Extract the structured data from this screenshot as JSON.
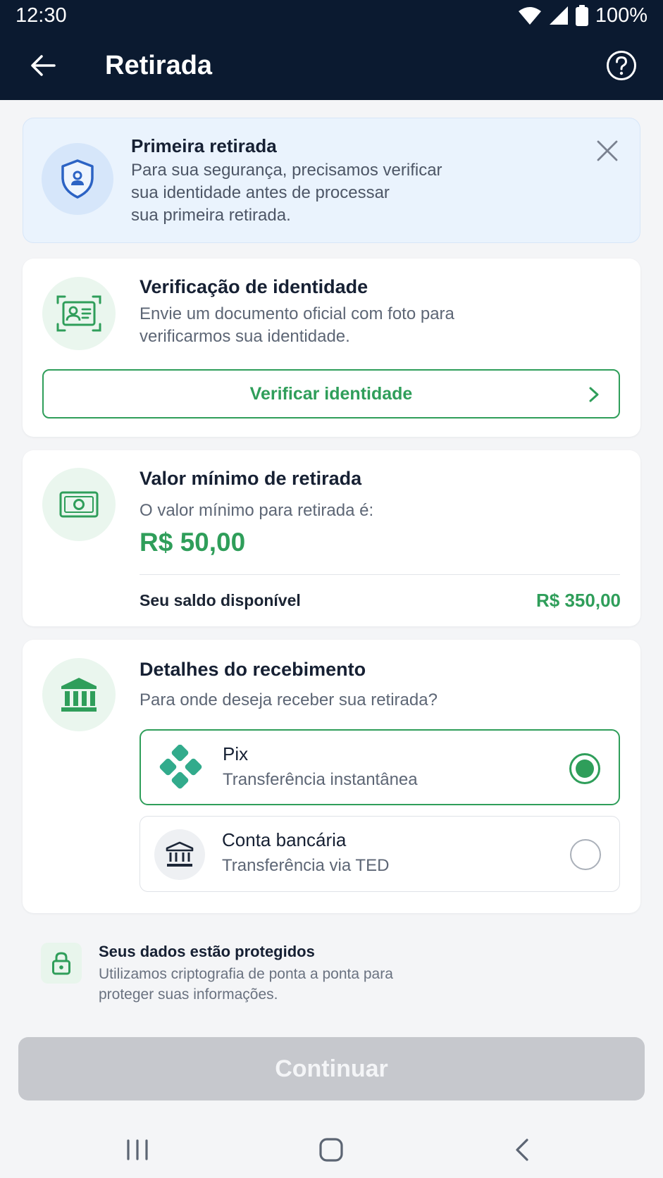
{
  "status_bar": {
    "time": "12:30",
    "battery": "100%"
  },
  "header": {
    "title": "Retirada"
  },
  "banner": {
    "title": "Primeira retirada",
    "line1": "Para sua segurança, precisamos verificar",
    "line2": "sua identidade antes de processar",
    "line3": "sua primeira retirada."
  },
  "identity": {
    "title": "Verificação de identidade",
    "line1": "Envie um documento oficial com foto para",
    "line2": "verificarmos sua identidade.",
    "button_label": "Verificar identidade"
  },
  "minimum": {
    "title": "Valor mínimo de retirada",
    "description": "O valor mínimo para retirada é:",
    "amount": "R$ 50,00",
    "balance_label": "Seu saldo disponível",
    "balance_value": "R$ 350,00"
  },
  "receipt": {
    "title": "Detalhes do recebimento",
    "question": "Para onde deseja receber sua retirada?",
    "options": [
      {
        "title": "Pix",
        "subtitle": "Transferência instantânea",
        "selected": true
      },
      {
        "title": "Conta bancária",
        "subtitle": "Transferência via TED",
        "selected": false
      }
    ]
  },
  "security": {
    "title": "Seus dados estão protegidos",
    "line1": "Utilizamos criptografia de ponta a ponta para",
    "line2": "proteger suas informações."
  },
  "footer": {
    "continue_label": "Continuar"
  },
  "colors": {
    "header_bg": "#0b1a30",
    "accent_green": "#2f9e5a",
    "banner_bg": "#eaf3fd",
    "disabled_button": "#c6c8cd"
  },
  "icons": {
    "banner": "shield-user-icon",
    "identity": "id-card-icon",
    "minimum": "banknote-icon",
    "receipt": "bank-icon",
    "pix": "pix-icon",
    "bank_account": "bank-icon",
    "security": "lock-icon"
  }
}
